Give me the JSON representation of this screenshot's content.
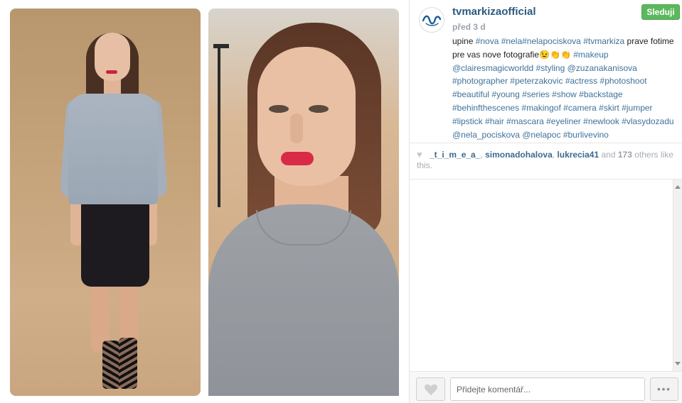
{
  "post": {
    "username": "tvmarkizaofficial",
    "timestamp": "před 3 d",
    "follow_label": "Sleduji",
    "avatar_icon": "markiza-logo-icon",
    "caption_text": "upine ",
    "caption_segments": [
      {
        "text": "upine ",
        "type": "text"
      },
      {
        "text": "#nova",
        "type": "tag"
      },
      {
        "text": " ",
        "type": "text"
      },
      {
        "text": "#nela#nelapociskova",
        "type": "tag"
      },
      {
        "text": " ",
        "type": "text"
      },
      {
        "text": "#tvmarkiza",
        "type": "tag"
      },
      {
        "text": " prave fotime pre vas nove fotografie😉👏👏 ",
        "type": "text"
      },
      {
        "text": "#makeup",
        "type": "tag"
      },
      {
        "text": " ",
        "type": "text"
      },
      {
        "text": "@clairesmagicworldd",
        "type": "tag"
      },
      {
        "text": " ",
        "type": "text"
      },
      {
        "text": "#styling",
        "type": "tag"
      },
      {
        "text": " ",
        "type": "text"
      },
      {
        "text": "@zuzanakanisova",
        "type": "tag"
      },
      {
        "text": " ",
        "type": "text"
      },
      {
        "text": "#photographer",
        "type": "tag"
      },
      {
        "text": " ",
        "type": "text"
      },
      {
        "text": "#peterzakovic",
        "type": "tag"
      },
      {
        "text": " ",
        "type": "text"
      },
      {
        "text": "#actress",
        "type": "tag"
      },
      {
        "text": " ",
        "type": "text"
      },
      {
        "text": "#photoshoot",
        "type": "tag"
      },
      {
        "text": " ",
        "type": "text"
      },
      {
        "text": "#beautiful",
        "type": "tag"
      },
      {
        "text": " ",
        "type": "text"
      },
      {
        "text": "#young",
        "type": "tag"
      },
      {
        "text": " ",
        "type": "text"
      },
      {
        "text": "#series",
        "type": "tag"
      },
      {
        "text": " ",
        "type": "text"
      },
      {
        "text": "#show",
        "type": "tag"
      },
      {
        "text": " ",
        "type": "text"
      },
      {
        "text": "#backstage",
        "type": "tag"
      },
      {
        "text": " ",
        "type": "text"
      },
      {
        "text": "#behinfthescenes",
        "type": "tag"
      },
      {
        "text": " ",
        "type": "text"
      },
      {
        "text": "#makingof",
        "type": "tag"
      },
      {
        "text": " ",
        "type": "text"
      },
      {
        "text": "#camera",
        "type": "tag"
      },
      {
        "text": " ",
        "type": "text"
      },
      {
        "text": "#skirt",
        "type": "tag"
      },
      {
        "text": " ",
        "type": "text"
      },
      {
        "text": "#jumper",
        "type": "tag"
      },
      {
        "text": " ",
        "type": "text"
      },
      {
        "text": "#lipstick",
        "type": "tag"
      },
      {
        "text": " ",
        "type": "text"
      },
      {
        "text": "#hair",
        "type": "tag"
      },
      {
        "text": " ",
        "type": "text"
      },
      {
        "text": "#mascara",
        "type": "tag"
      },
      {
        "text": " ",
        "type": "text"
      },
      {
        "text": "#eyeliner",
        "type": "tag"
      },
      {
        "text": " ",
        "type": "text"
      },
      {
        "text": "#newlook",
        "type": "tag"
      },
      {
        "text": " ",
        "type": "text"
      },
      {
        "text": "#vlasydozadu",
        "type": "tag"
      },
      {
        "text": " ",
        "type": "text"
      },
      {
        "text": "@nela_pociskova",
        "type": "tag"
      },
      {
        "text": " ",
        "type": "text"
      },
      {
        "text": "@nelapoc",
        "type": "tag"
      },
      {
        "text": " ",
        "type": "text"
      },
      {
        "text": "#burlivevino",
        "type": "tag"
      }
    ]
  },
  "likes": {
    "icon": "heart-icon",
    "users": [
      "_t_i_m_e_a_",
      "simonadohalova",
      "lukrecia41"
    ],
    "separator": ", ",
    "and_text": " and ",
    "count": "173",
    "others_text": " others like this."
  },
  "footer": {
    "like_icon": "heart-icon",
    "comment_placeholder": "Přidejte komentář...",
    "more_label": "•••"
  },
  "colors": {
    "link": "#3f729b",
    "username": "#2a5a80",
    "follow_bg": "#5cb85c",
    "muted": "#9ba3ab"
  }
}
